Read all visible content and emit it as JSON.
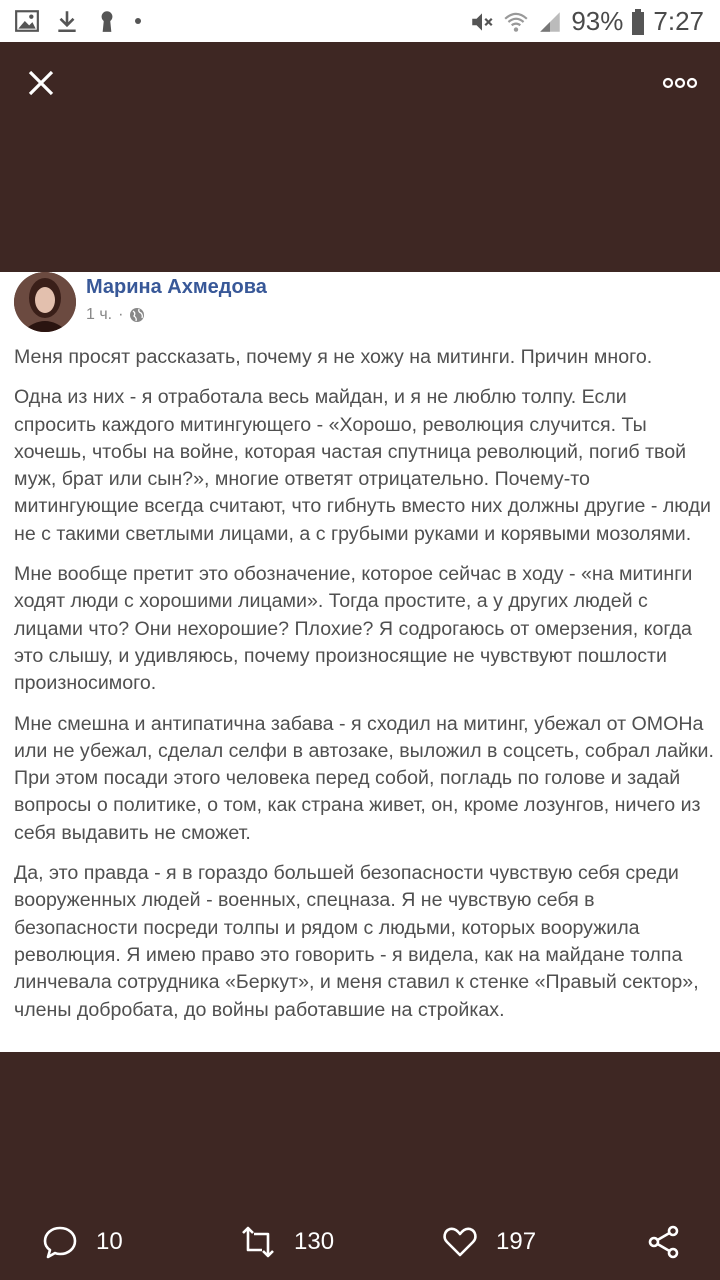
{
  "status_bar": {
    "battery": "93%",
    "time": "7:27",
    "icons": [
      "image-icon",
      "download-icon",
      "keyhole-icon",
      "dot-icon",
      "mute-icon",
      "wifi-icon",
      "signal-icon",
      "battery-icon"
    ]
  },
  "post": {
    "author": "Марина Ахмедова",
    "time": "1 ч.",
    "separator": "·",
    "paragraphs": [
      "Меня просят рассказать, почему я не хожу на митинги. Причин много.",
      "Одна из них - я отработала весь майдан, и я не люблю толпу. Если спросить каждого митингующего - «Хорошо, революция случится. Ты хочешь, чтобы на войне, которая частая спутница революций, погиб твой муж, брат или сын?», многие ответят отрицательно. Почему-то митингующие всегда считают, что гибнуть вместо них должны другие - люди не с такими светлыми лицами, а с грубыми руками и корявыми мозолями.",
      "Мне вообще претит это обозначение, которое сейчас в ходу - «на митинги ходят люди с хорошими лицами». Тогда простите, а у других людей с лицами что? Они нехорошие? Плохие? Я содрогаюсь от омерзения, когда это слышу, и удивляюсь, почему произносящие не чувствуют пошлости произносимого.",
      "Мне смешна и антипатична забава - я сходил на митинг, убежал от ОМОНа или не убежал, сделал селфи в автозаке, выложил в соцсеть, собрал лайки. При этом посади этого человека перед собой, погладь по голове и задай вопросы о политике, о том, как страна живет, он, кроме лозунгов, ничего из себя выдавить не сможет.",
      "Да, это правда - я в гораздо большей безопасности чувствую себя среди вооруженных людей - военных, спецназа. Я не чувствую себя в безопасности посреди толпы и рядом с людьми, которых вооружила революция. Я имею право это говорить - я видела, как на майдане толпа линчевала сотрудника «Беркут», и меня ставил к стенке «Правый сектор», члены добробата, до войны работавшие на стройках."
    ]
  },
  "actions": {
    "comments": "10",
    "retweets": "130",
    "likes": "197"
  },
  "colors": {
    "background": "#3e2723",
    "author": "#385898",
    "text": "#505050"
  }
}
